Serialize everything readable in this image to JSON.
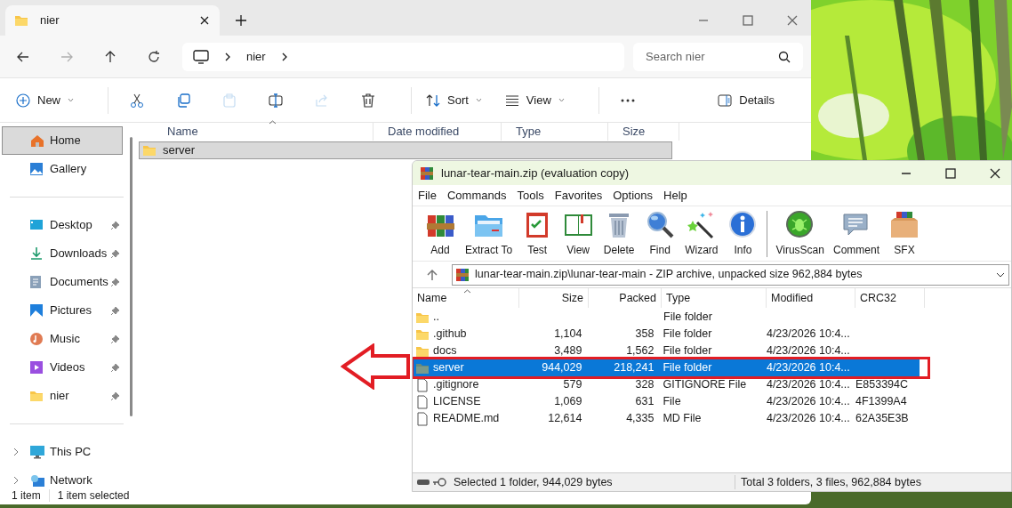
{
  "explorer": {
    "tab": {
      "title": "nier"
    },
    "nav": [
      {
        "kind": "back",
        "disabled": false
      },
      {
        "kind": "forward",
        "disabled": true
      },
      {
        "kind": "up",
        "disabled": false
      },
      {
        "kind": "refresh",
        "disabled": false
      }
    ],
    "address": {
      "crumbs": [
        "nier"
      ]
    },
    "search": {
      "placeholder": "Search nier"
    },
    "toolbar": [
      {
        "kind": "new",
        "label": "New",
        "disabled": false
      },
      {
        "kind": "separator"
      },
      {
        "kind": "cut",
        "disabled": false
      },
      {
        "kind": "copy",
        "disabled": false
      },
      {
        "kind": "paste",
        "disabled": true
      },
      {
        "kind": "rename",
        "disabled": false
      },
      {
        "kind": "share",
        "disabled": true
      },
      {
        "kind": "delete",
        "disabled": false
      },
      {
        "kind": "separator"
      },
      {
        "kind": "sort",
        "label": "Sort",
        "disabled": false
      },
      {
        "kind": "view",
        "label": "View",
        "disabled": false
      },
      {
        "kind": "separator"
      },
      {
        "kind": "more",
        "disabled": false
      },
      {
        "kind": "details",
        "label": "Details",
        "disabled": false
      }
    ],
    "sidebar": {
      "sections": [
        {
          "items": [
            {
              "kind": "home",
              "label": "Home",
              "pinned": false,
              "selected": true
            },
            {
              "kind": "gallery",
              "label": "Gallery",
              "pinned": false,
              "selected": false
            }
          ]
        },
        {
          "items": [
            {
              "kind": "desktop",
              "label": "Desktop",
              "pinned": true,
              "selected": false
            },
            {
              "kind": "downloads",
              "label": "Downloads",
              "pinned": true,
              "selected": false
            },
            {
              "kind": "documents",
              "label": "Documents",
              "pinned": true,
              "selected": false
            },
            {
              "kind": "pictures",
              "label": "Pictures",
              "pinned": true,
              "selected": false
            },
            {
              "kind": "music",
              "label": "Music",
              "pinned": true,
              "selected": false
            },
            {
              "kind": "videos",
              "label": "Videos",
              "pinned": true,
              "selected": false
            },
            {
              "kind": "folder",
              "label": "nier",
              "pinned": true,
              "selected": false
            }
          ]
        },
        {
          "items": [
            {
              "kind": "pc",
              "label": "This PC",
              "pinned": false,
              "selected": false,
              "expandable": true
            },
            {
              "kind": "network",
              "label": "Network",
              "pinned": false,
              "selected": false,
              "expandable": true
            }
          ]
        }
      ]
    },
    "columns": [
      "Name",
      "Date modified",
      "Type",
      "Size"
    ],
    "rows": [
      {
        "name": "server",
        "selected": true
      }
    ],
    "status": [
      "1 item",
      "1 item selected"
    ]
  },
  "winrar": {
    "title": "lunar-tear-main.zip (evaluation copy)",
    "menu": [
      "File",
      "Commands",
      "Tools",
      "Favorites",
      "Options",
      "Help"
    ],
    "tools": [
      {
        "kind": "add",
        "label": "Add"
      },
      {
        "kind": "extract",
        "label": "Extract To"
      },
      {
        "kind": "test",
        "label": "Test"
      },
      {
        "kind": "view",
        "label": "View"
      },
      {
        "kind": "delete",
        "label": "Delete"
      },
      {
        "kind": "find",
        "label": "Find"
      },
      {
        "kind": "wizard",
        "label": "Wizard"
      },
      {
        "kind": "info",
        "label": "Info"
      },
      {
        "kind": "separator"
      },
      {
        "kind": "virusscan",
        "label": "VirusScan"
      },
      {
        "kind": "comment",
        "label": "Comment"
      },
      {
        "kind": "sfx",
        "label": "SFX"
      }
    ],
    "path": "lunar-tear-main.zip\\lunar-tear-main - ZIP archive, unpacked size 962,884 bytes",
    "columns": [
      "Name",
      "Size",
      "Packed",
      "Type",
      "Modified",
      "CRC32"
    ],
    "rows": [
      {
        "kind": "folder",
        "name": "..",
        "size": "",
        "packed": "",
        "type": "File folder",
        "modified": "",
        "crc": "",
        "selected": false
      },
      {
        "kind": "folder",
        "name": ".github",
        "size": "1,104",
        "packed": "358",
        "type": "File folder",
        "modified": "4/23/2026 10:4...",
        "crc": "",
        "selected": false
      },
      {
        "kind": "folder",
        "name": "docs",
        "size": "3,489",
        "packed": "1,562",
        "type": "File folder",
        "modified": "4/23/2026 10:4...",
        "crc": "",
        "selected": false
      },
      {
        "kind": "folder",
        "name": "server",
        "size": "944,029",
        "packed": "218,241",
        "type": "File folder",
        "modified": "4/23/2026 10:4...",
        "crc": "",
        "selected": true,
        "highlighted": true
      },
      {
        "kind": "file",
        "name": ".gitignore",
        "size": "579",
        "packed": "328",
        "type": "GITIGNORE File",
        "modified": "4/23/2026 10:4...",
        "crc": "E853394C",
        "selected": false
      },
      {
        "kind": "file",
        "name": "LICENSE",
        "size": "1,069",
        "packed": "631",
        "type": "File",
        "modified": "4/23/2026 10:4...",
        "crc": "4F1399A4",
        "selected": false
      },
      {
        "kind": "file",
        "name": "README.md",
        "size": "12,614",
        "packed": "4,335",
        "type": "MD File",
        "modified": "4/23/2026 10:4...",
        "crc": "62A35E3B",
        "selected": false
      }
    ],
    "status_left": "Selected 1 folder, 944,029 bytes",
    "status_right": "Total 3 folders, 3 files, 962,884 bytes"
  }
}
